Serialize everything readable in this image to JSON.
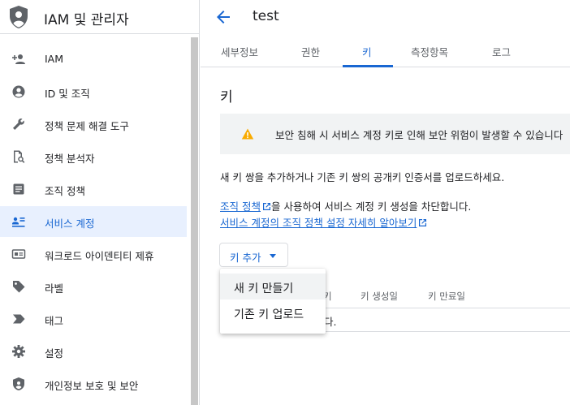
{
  "sidebar": {
    "title": "IAM 및 관리자",
    "items": [
      {
        "label": "IAM",
        "icon": "add-person-icon"
      },
      {
        "label": "ID 및 조직",
        "icon": "account-circle-icon"
      },
      {
        "label": "정책 문제 해결 도구",
        "icon": "wrench-icon"
      },
      {
        "label": "정책 분석자",
        "icon": "document-search-icon"
      },
      {
        "label": "조직 정책",
        "icon": "article-icon"
      },
      {
        "label": "서비스 계정",
        "icon": "service-account-icon"
      },
      {
        "label": "워크로드 아이덴티티 제휴",
        "icon": "id-card-icon"
      },
      {
        "label": "라벨",
        "icon": "label-icon"
      },
      {
        "label": "태그",
        "icon": "tag-chevron-icon"
      },
      {
        "label": "설정",
        "icon": "gear-icon"
      },
      {
        "label": "개인정보 보호 및 보안",
        "icon": "shield-icon"
      }
    ],
    "active_index": 5
  },
  "header": {
    "title": "test"
  },
  "tabs": [
    {
      "label": "세부정보"
    },
    {
      "label": "권한"
    },
    {
      "label": "키"
    },
    {
      "label": "측정항목"
    },
    {
      "label": "로그"
    }
  ],
  "active_tab": 2,
  "section_title": "키",
  "warning": {
    "text": "보안 침해 시 서비스 계정 키로 인해 보안 위험이 발생할 수 있습니다"
  },
  "description": "새 키 쌍을 추가하거나 기존 키 쌍의 공개키 인증서를 업로드하세요.",
  "policy": {
    "link_text": "조직 정책",
    "rest_text": "을 사용하여 서비스 계정 키 생성을 차단합니다.",
    "learn_more": "서비스 계정의 조직 정책 설정 자세히 알아보기"
  },
  "add_key_button": {
    "label": "키 추가"
  },
  "menu": {
    "items": [
      {
        "label": "새 키 만들기"
      },
      {
        "label": "기존 키 업로드"
      }
    ]
  },
  "table": {
    "headers": [
      "키",
      "키 생성일",
      "키 만료일"
    ],
    "empty_fragment": "다."
  },
  "colors": {
    "accent": "#1967d2",
    "active_bg": "#e8f0fe",
    "warning": "#f9ab00"
  }
}
